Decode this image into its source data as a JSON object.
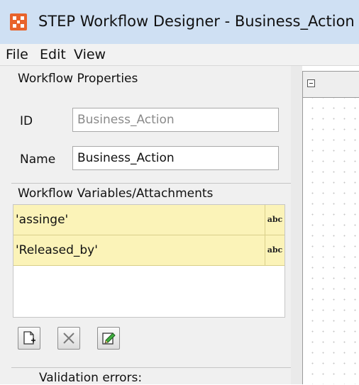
{
  "window": {
    "title": "STEP Workflow Designer - Business_Action"
  },
  "menu": {
    "items": [
      "File",
      "Edit",
      "View"
    ]
  },
  "properties": {
    "section_title": "Workflow Properties",
    "id_label": "ID",
    "id_value": "Business_Action",
    "name_label": "Name",
    "name_value": "Business_Action"
  },
  "variables": {
    "section_title": "Workflow Variables/Attachments",
    "rows": [
      {
        "name": "'assinge'",
        "type": "abc"
      },
      {
        "name": "'Released_by'",
        "type": "abc"
      }
    ]
  },
  "toolbar": {
    "buttons": [
      "add-variable",
      "delete-variable",
      "edit-variable"
    ]
  },
  "validation": {
    "label": "Validation errors:"
  },
  "colors": {
    "title_bar": "#cfe0f3",
    "row_highlight": "#fbf3b8",
    "app_icon": "#e8632b"
  }
}
